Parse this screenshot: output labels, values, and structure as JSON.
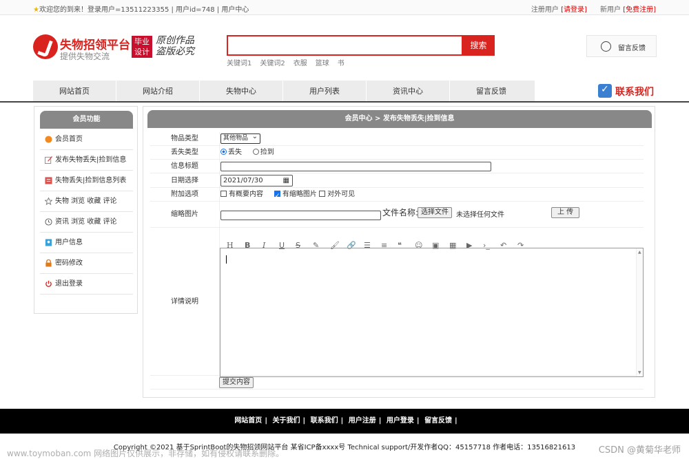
{
  "topbar": {
    "welcome": "欢迎您的到来！登录用户=13511223355 | 用户id=748 | 用户中心",
    "register_user": "注册用户",
    "login_link": "[请登录]",
    "new_user": "新用户",
    "free_register": "[免费注册]"
  },
  "header": {
    "logo_title": "失物招领平台",
    "logo_sub": "提供失物交流",
    "badge_line1": "毕业",
    "badge_line2": "设计",
    "slogan_line1": "原创作品",
    "slogan_line2": "盗版必究",
    "search_value": "",
    "search_button": "搜索",
    "keywords": [
      "关键词1",
      "关键词2",
      "衣服",
      "篮球",
      "书"
    ],
    "feedback": "留言反馈"
  },
  "nav": {
    "items": [
      "网站首页",
      "网站介绍",
      "失物中心",
      "用户列表",
      "资讯中心",
      "留言反馈"
    ],
    "contact": "联系我们"
  },
  "sidebar": {
    "title": "会员功能",
    "items": [
      {
        "label": "会员首页",
        "icon": "home-icon",
        "color": "#f08a24"
      },
      {
        "label": "发布失物丢失|捡到信息",
        "icon": "edit-icon",
        "color": "#d9534f"
      },
      {
        "label": "失物丢失|捡到信息列表",
        "icon": "list-icon",
        "color": "#d9534f"
      },
      {
        "label": "失物 浏览 收藏 评论",
        "icon": "star-icon",
        "color": "#777777"
      },
      {
        "label": "资讯 浏览 收藏 评论",
        "icon": "clock-icon",
        "color": "#555555"
      },
      {
        "label": "用户信息",
        "icon": "user-card-icon",
        "color": "#3aa0d8"
      },
      {
        "label": "密码修改",
        "icon": "lock-icon",
        "color": "#e07b1a"
      },
      {
        "label": "退出登录",
        "icon": "power-icon",
        "color": "#d9231f"
      }
    ]
  },
  "main": {
    "breadcrumb": "会员中心 > 发布失物丢失|捡到信息",
    "form": {
      "category_label": "物品类型",
      "category_value": "其他物品",
      "loss_type_label": "丢失类型",
      "loss_option": "丢失",
      "found_option": "捡到",
      "title_label": "信息标题",
      "title_value": "",
      "date_label": "日期选择",
      "date_value": "2021/07/30",
      "extra_label": "附加选项",
      "opt_summary": "有概要内容",
      "opt_thumb": "有缩略图片",
      "opt_public": "对外可见",
      "thumb_label": "缩略图片",
      "file_name_label": "文件名称:",
      "choose_file": "选择文件",
      "no_file": "未选择任何文件",
      "upload": "上 传",
      "detail_label": "详情说明",
      "submit": "提交内容"
    },
    "editor_tools": [
      "H",
      "B",
      "I",
      "U",
      "S",
      "✎",
      "🖌",
      "🔗",
      "☰",
      "≡",
      "❝",
      "☺",
      "▣",
      "▦",
      "▶",
      "›_",
      "↶",
      "↷"
    ]
  },
  "footer": {
    "links": [
      "网站首页",
      "关于我们",
      "联系我们",
      "用户注册",
      "用户登录",
      "留言反馈"
    ],
    "copyright": "Copyright ©2021 基于SprintBoot的失物招领网站平台    某省ICP备xxxx号    Technical support/开发作者QQ：45157718    作者电话：13516821613",
    "watermark_left": "www.toymoban.com 网络图片仅供展示，非存储，如有侵权请联系删除。",
    "watermark_right": "CSDN @黄菊华老师"
  }
}
